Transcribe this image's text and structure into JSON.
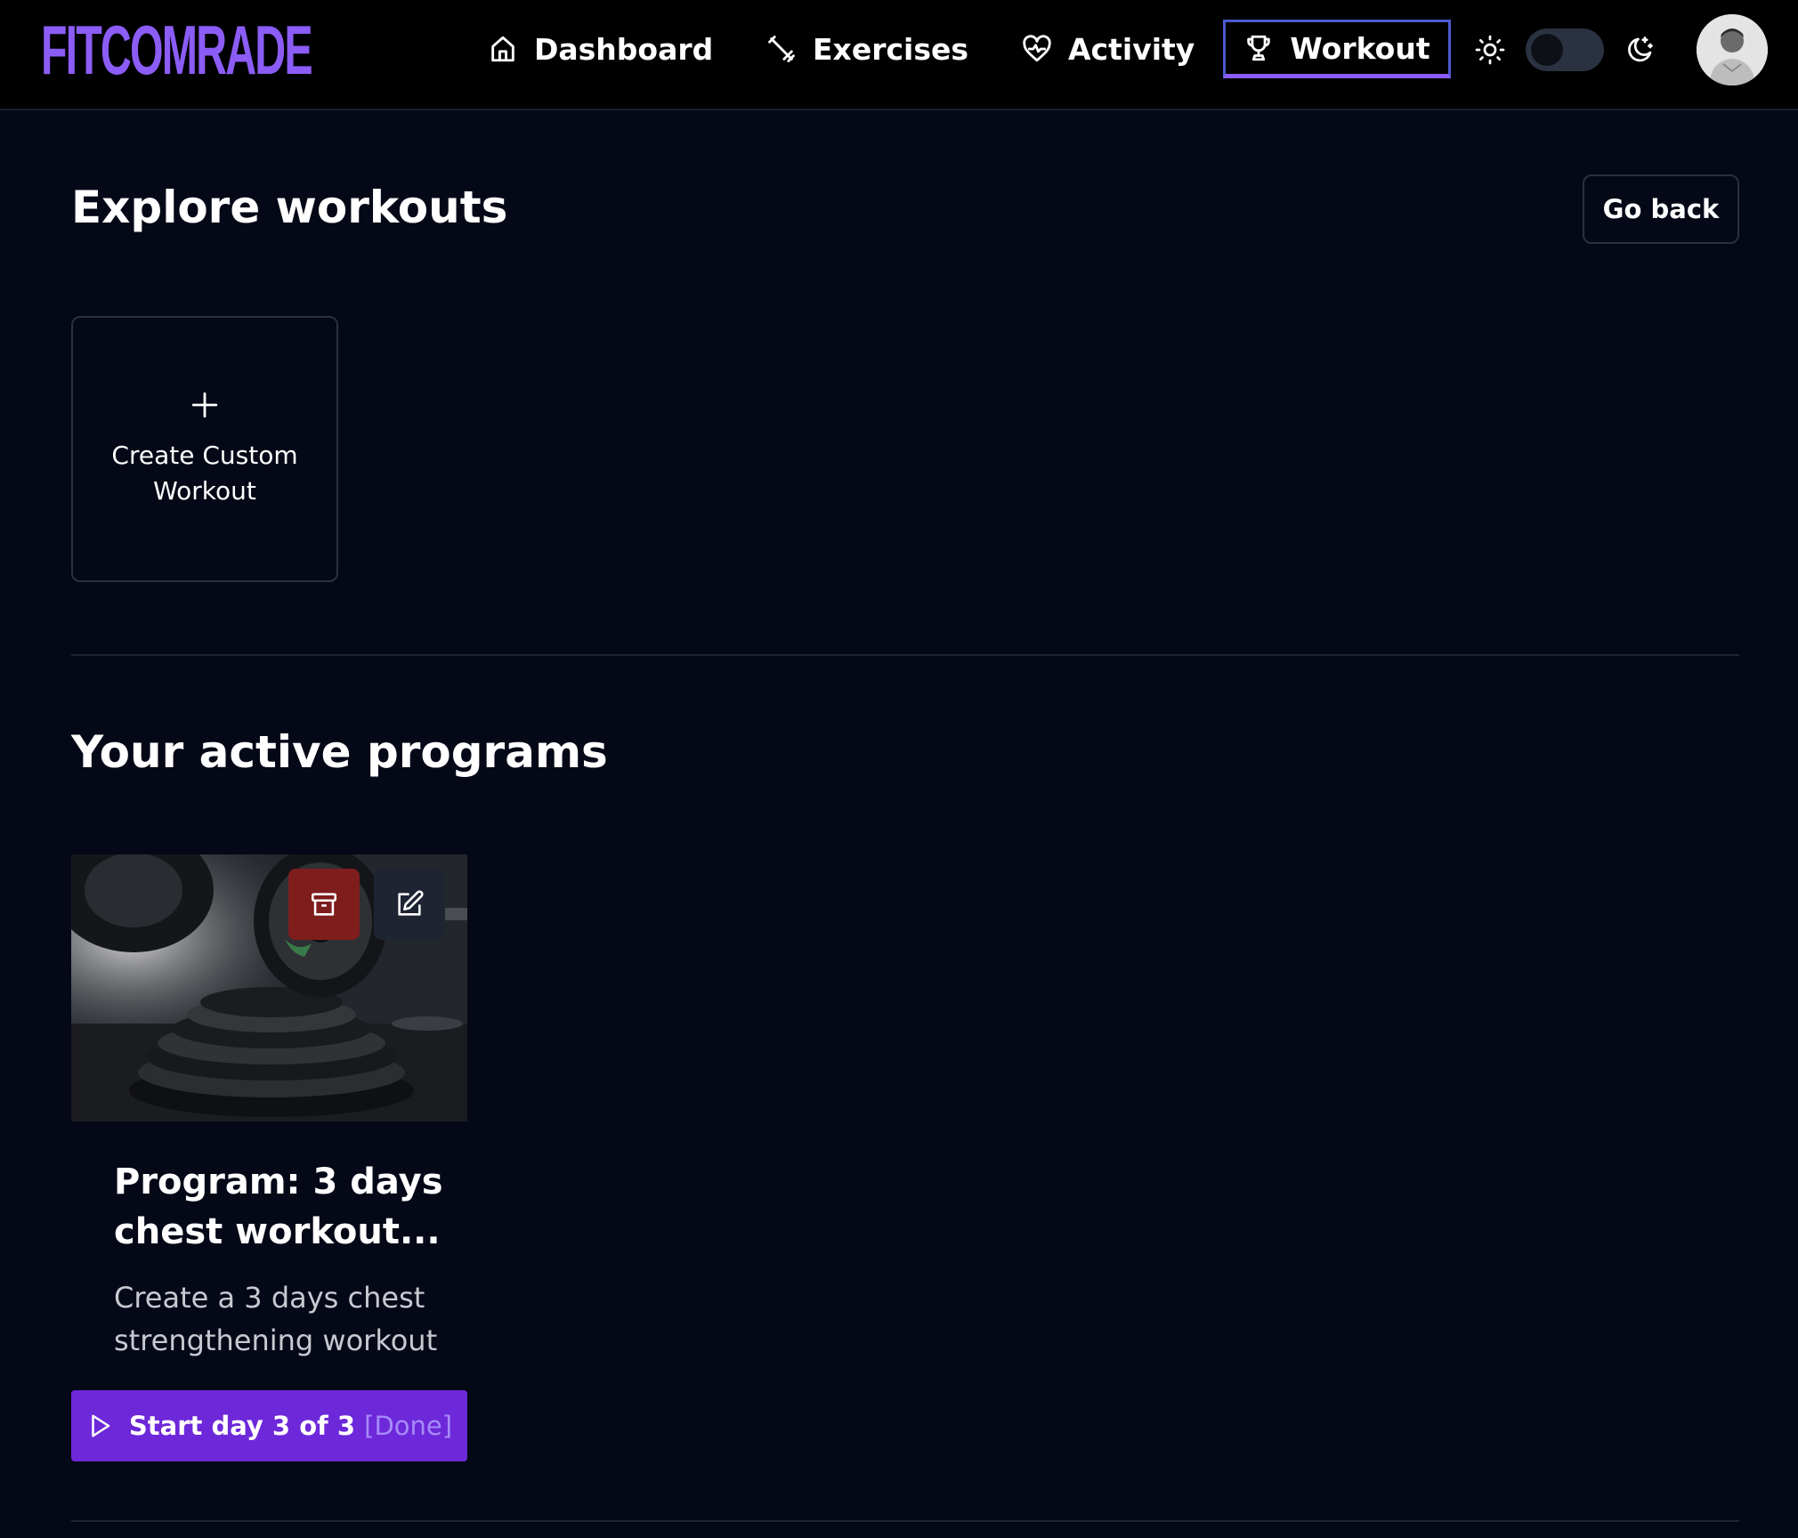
{
  "app": {
    "logo_text": "FITCOMRADE"
  },
  "nav": {
    "items": [
      {
        "label": "Dashboard",
        "icon": "home-icon",
        "active": false
      },
      {
        "label": "Exercises",
        "icon": "dumbbell-icon",
        "active": false
      },
      {
        "label": "Activity",
        "icon": "heart-pulse-icon",
        "active": false
      },
      {
        "label": "Workout",
        "icon": "trophy-icon",
        "active": true
      }
    ],
    "theme_toggle": {
      "light_icon": "sun-icon",
      "dark_icon": "moon-icon",
      "dark_mode": true
    },
    "avatar_icon": "user-avatar"
  },
  "explore": {
    "title": "Explore workouts",
    "go_back_label": "Go back",
    "create_card": {
      "icon": "plus-icon",
      "label": "Create Custom Workout"
    }
  },
  "active_programs": {
    "title": "Your active programs",
    "programs": [
      {
        "title": "Program: 3 days chest workout...",
        "description": "Create a 3 days chest strengthening workout",
        "archive_icon": "archive-icon",
        "edit_icon": "edit-icon",
        "start_label": "Start day 3 of 3",
        "start_status": "[Done]",
        "start_icon": "play-icon"
      }
    ]
  },
  "colors": {
    "background": "#050816",
    "accent": "#8b5cf6",
    "primary_button": "#6d28d9",
    "archive_button": "#7f1d1d",
    "border": "#2b3040"
  }
}
